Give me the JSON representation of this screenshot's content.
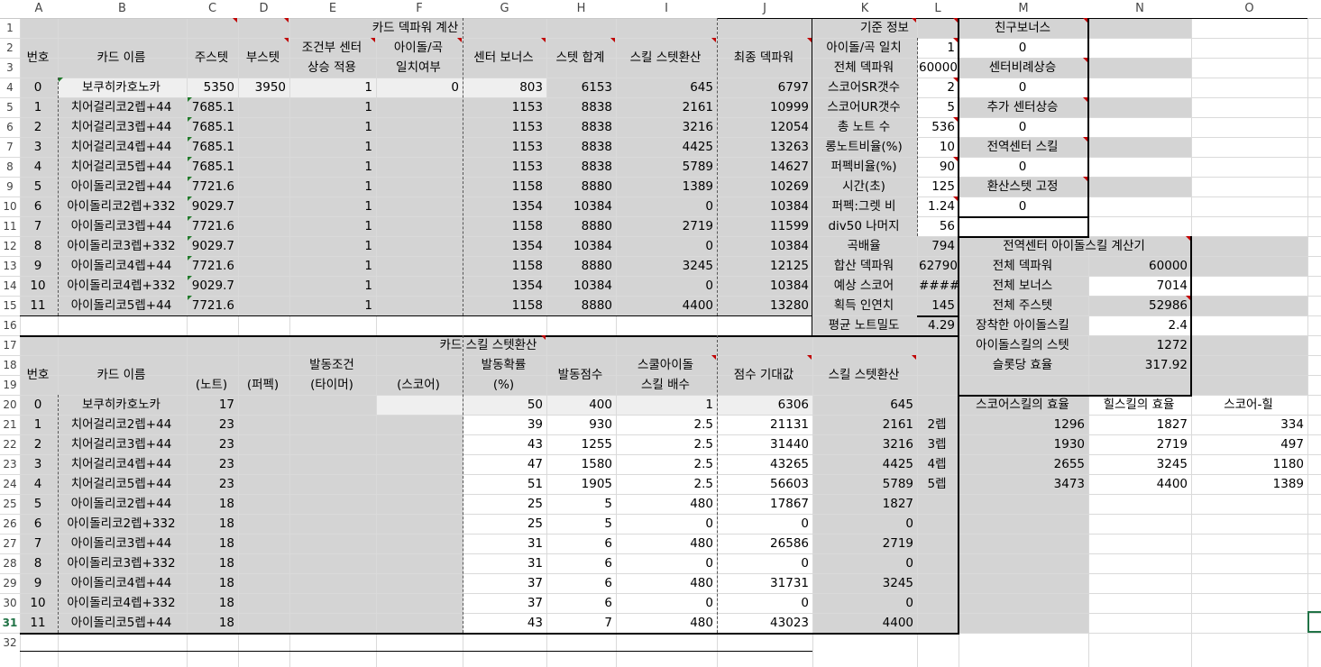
{
  "columns": [
    "A",
    "B",
    "C",
    "D",
    "E",
    "F",
    "G",
    "H",
    "I",
    "J",
    "K",
    "L",
    "M",
    "N",
    "O"
  ],
  "rows": [
    "1",
    "2",
    "3",
    "4",
    "5",
    "6",
    "7",
    "8",
    "9",
    "10",
    "11",
    "12",
    "13",
    "14",
    "15",
    "16",
    "17",
    "18",
    "19",
    "20",
    "21",
    "22",
    "23",
    "24",
    "25",
    "26",
    "27",
    "28",
    "29",
    "30",
    "31",
    "32"
  ],
  "deck": {
    "title": "카드 덱파워 계산",
    "headers": {
      "no": "번호",
      "name": "카드 이름",
      "main_stat": "주스텟",
      "boost_stat": "부스텟",
      "cond_center_1": "조건부 센터",
      "cond_center_2": "상승 적용",
      "idol_match_1": "아이돌/곡",
      "idol_match_2": "일치여부",
      "center_bonus": "센터 보너스",
      "stat_sum": "스텟 합계",
      "skill_conv": "스킬 스텟환산",
      "final_power": "최종 덱파워"
    },
    "rows": [
      {
        "no": "0",
        "name": "보쿠히카호노카",
        "main": "5350",
        "boost": "3950",
        "cond": "1",
        "match": "0",
        "center": "803",
        "sum": "6153",
        "skill": "645",
        "final": "6797"
      },
      {
        "no": "1",
        "name": "치어걸리코2렙+44",
        "main": "7685.1",
        "boost": "",
        "cond": "1",
        "match": "",
        "center": "1153",
        "sum": "8838",
        "skill": "2161",
        "final": "10999"
      },
      {
        "no": "2",
        "name": "치어걸리코3렙+44",
        "main": "7685.1",
        "boost": "",
        "cond": "1",
        "match": "",
        "center": "1153",
        "sum": "8838",
        "skill": "3216",
        "final": "12054"
      },
      {
        "no": "3",
        "name": "치어걸리코4렙+44",
        "main": "7685.1",
        "boost": "",
        "cond": "1",
        "match": "",
        "center": "1153",
        "sum": "8838",
        "skill": "4425",
        "final": "13263"
      },
      {
        "no": "4",
        "name": "치어걸리코5렙+44",
        "main": "7685.1",
        "boost": "",
        "cond": "1",
        "match": "",
        "center": "1153",
        "sum": "8838",
        "skill": "5789",
        "final": "14627"
      },
      {
        "no": "5",
        "name": "아이돌리코2렙+44",
        "main": "7721.6",
        "boost": "",
        "cond": "1",
        "match": "",
        "center": "1158",
        "sum": "8880",
        "skill": "1389",
        "final": "10269"
      },
      {
        "no": "6",
        "name": "아이돌리코2렙+332",
        "main": "9029.7",
        "boost": "",
        "cond": "1",
        "match": "",
        "center": "1354",
        "sum": "10384",
        "skill": "0",
        "final": "10384"
      },
      {
        "no": "7",
        "name": "아이돌리코3렙+44",
        "main": "7721.6",
        "boost": "",
        "cond": "1",
        "match": "",
        "center": "1158",
        "sum": "8880",
        "skill": "2719",
        "final": "11599"
      },
      {
        "no": "8",
        "name": "아이돌리코3렙+332",
        "main": "9029.7",
        "boost": "",
        "cond": "1",
        "match": "",
        "center": "1354",
        "sum": "10384",
        "skill": "0",
        "final": "10384"
      },
      {
        "no": "9",
        "name": "아이돌리코4렙+44",
        "main": "7721.6",
        "boost": "",
        "cond": "1",
        "match": "",
        "center": "1158",
        "sum": "8880",
        "skill": "3245",
        "final": "12125"
      },
      {
        "no": "10",
        "name": "아이돌리코4렙+332",
        "main": "9029.7",
        "boost": "",
        "cond": "1",
        "match": "",
        "center": "1354",
        "sum": "10384",
        "skill": "0",
        "final": "10384"
      },
      {
        "no": "11",
        "name": "아이돌리코5렙+44",
        "main": "7721.6",
        "boost": "",
        "cond": "1",
        "match": "",
        "center": "1158",
        "sum": "8880",
        "skill": "4400",
        "final": "13280"
      }
    ]
  },
  "reference": {
    "title": "기준 정보",
    "items": [
      {
        "label": "아이돌/곡 일치",
        "value": "1"
      },
      {
        "label": "전체 덱파워",
        "value": "60000"
      },
      {
        "label": "스코어SR갯수",
        "value": "2"
      },
      {
        "label": "스코어UR갯수",
        "value": "5"
      },
      {
        "label": "총 노트 수",
        "value": "536"
      },
      {
        "label": "롱노트비율(%)",
        "value": "10"
      },
      {
        "label": "퍼펙비율(%)",
        "value": "90"
      },
      {
        "label": "시간(초)",
        "value": "125"
      },
      {
        "label": "퍼펙:그렛 비",
        "value": "1.24"
      },
      {
        "label": "div50 나머지",
        "value": "56"
      },
      {
        "label": "곡배율",
        "value": "794"
      },
      {
        "label": "합산 덱파워",
        "value": "62790"
      },
      {
        "label": "예상 스코어",
        "value": "####"
      },
      {
        "label": "획득 인연치",
        "value": "145"
      },
      {
        "label": "평균 노트밀도",
        "value": "4.29"
      }
    ]
  },
  "bonus": [
    {
      "label": "친구보너스",
      "value": "0"
    },
    {
      "label": "센터비례상승",
      "value": "0"
    },
    {
      "label": "추가 센터상승",
      "value": "0"
    },
    {
      "label": "전역센터 스킬",
      "value": "0"
    },
    {
      "label": "환산스텟 고정",
      "value": "0"
    }
  ],
  "global_calc": {
    "title": "전역센터 아이돌스킬 계산기",
    "items": [
      {
        "label": "전체 덱파워",
        "value": "60000"
      },
      {
        "label": "전체 보너스",
        "value": "7014"
      },
      {
        "label": "전체 주스텟",
        "value": "52986"
      },
      {
        "label": "장착한 아이돌스킬",
        "value": "2.4"
      },
      {
        "label": "아이돌스킬의 스텟",
        "value": "1272"
      },
      {
        "label": "슬롯당 효율",
        "value": "317.92"
      }
    ]
  },
  "skill": {
    "title": "카드 스킬 스텟환산",
    "headers": {
      "no": "번호",
      "name": "카드 이름",
      "trigger": "발동조건",
      "note": "(노트)",
      "perfect": "(퍼펙)",
      "timer": "(타이머)",
      "score": "(스코어)",
      "prob_1": "발동확률",
      "prob_2": "(%)",
      "points": "발동점수",
      "cool_1": "스쿨아이돌",
      "cool_2": "스킬 배수",
      "expected": "점수 기대값",
      "conv": "스킬 스텟환산"
    },
    "rows": [
      {
        "no": "0",
        "name": "보쿠히카호노카",
        "note": "17",
        "prob": "50",
        "points": "400",
        "mult": "1",
        "expected": "6306",
        "conv": "645"
      },
      {
        "no": "1",
        "name": "치어걸리코2렙+44",
        "note": "23",
        "prob": "39",
        "points": "930",
        "mult": "2.5",
        "expected": "21131",
        "conv": "2161"
      },
      {
        "no": "2",
        "name": "치어걸리코3렙+44",
        "note": "23",
        "prob": "43",
        "points": "1255",
        "mult": "2.5",
        "expected": "31440",
        "conv": "3216"
      },
      {
        "no": "3",
        "name": "치어걸리코4렙+44",
        "note": "23",
        "prob": "47",
        "points": "1580",
        "mult": "2.5",
        "expected": "43265",
        "conv": "4425"
      },
      {
        "no": "4",
        "name": "치어걸리코5렙+44",
        "note": "23",
        "prob": "51",
        "points": "1905",
        "mult": "2.5",
        "expected": "56603",
        "conv": "5789"
      },
      {
        "no": "5",
        "name": "아이돌리코2렙+44",
        "note": "18",
        "prob": "25",
        "points": "5",
        "mult": "480",
        "expected": "17867",
        "conv": "1827"
      },
      {
        "no": "6",
        "name": "아이돌리코2렙+332",
        "note": "18",
        "prob": "25",
        "points": "5",
        "mult": "0",
        "expected": "0",
        "conv": "0"
      },
      {
        "no": "7",
        "name": "아이돌리코3렙+44",
        "note": "18",
        "prob": "31",
        "points": "6",
        "mult": "480",
        "expected": "26586",
        "conv": "2719"
      },
      {
        "no": "8",
        "name": "아이돌리코3렙+332",
        "note": "18",
        "prob": "31",
        "points": "6",
        "mult": "0",
        "expected": "0",
        "conv": "0"
      },
      {
        "no": "9",
        "name": "아이돌리코4렙+44",
        "note": "18",
        "prob": "37",
        "points": "6",
        "mult": "480",
        "expected": "31731",
        "conv": "3245"
      },
      {
        "no": "10",
        "name": "아이돌리코4렙+332",
        "note": "18",
        "prob": "37",
        "points": "6",
        "mult": "0",
        "expected": "0",
        "conv": "0"
      },
      {
        "no": "11",
        "name": "아이돌리코5렙+44",
        "note": "18",
        "prob": "43",
        "points": "7",
        "mult": "480",
        "expected": "43023",
        "conv": "4400"
      }
    ]
  },
  "efficiency": {
    "headers": {
      "score": "스코어스킬의 효율",
      "heal": "힐스킬의 효율",
      "diff": "스코어-힐"
    },
    "rows": [
      {
        "level": "2렙",
        "score": "1296",
        "heal": "1827",
        "diff": "334"
      },
      {
        "level": "3렙",
        "score": "1930",
        "heal": "2719",
        "diff": "497"
      },
      {
        "level": "4렙",
        "score": "2655",
        "heal": "3245",
        "diff": "1180"
      },
      {
        "level": "5렙",
        "score": "3473",
        "heal": "4400",
        "diff": "1389"
      }
    ]
  }
}
